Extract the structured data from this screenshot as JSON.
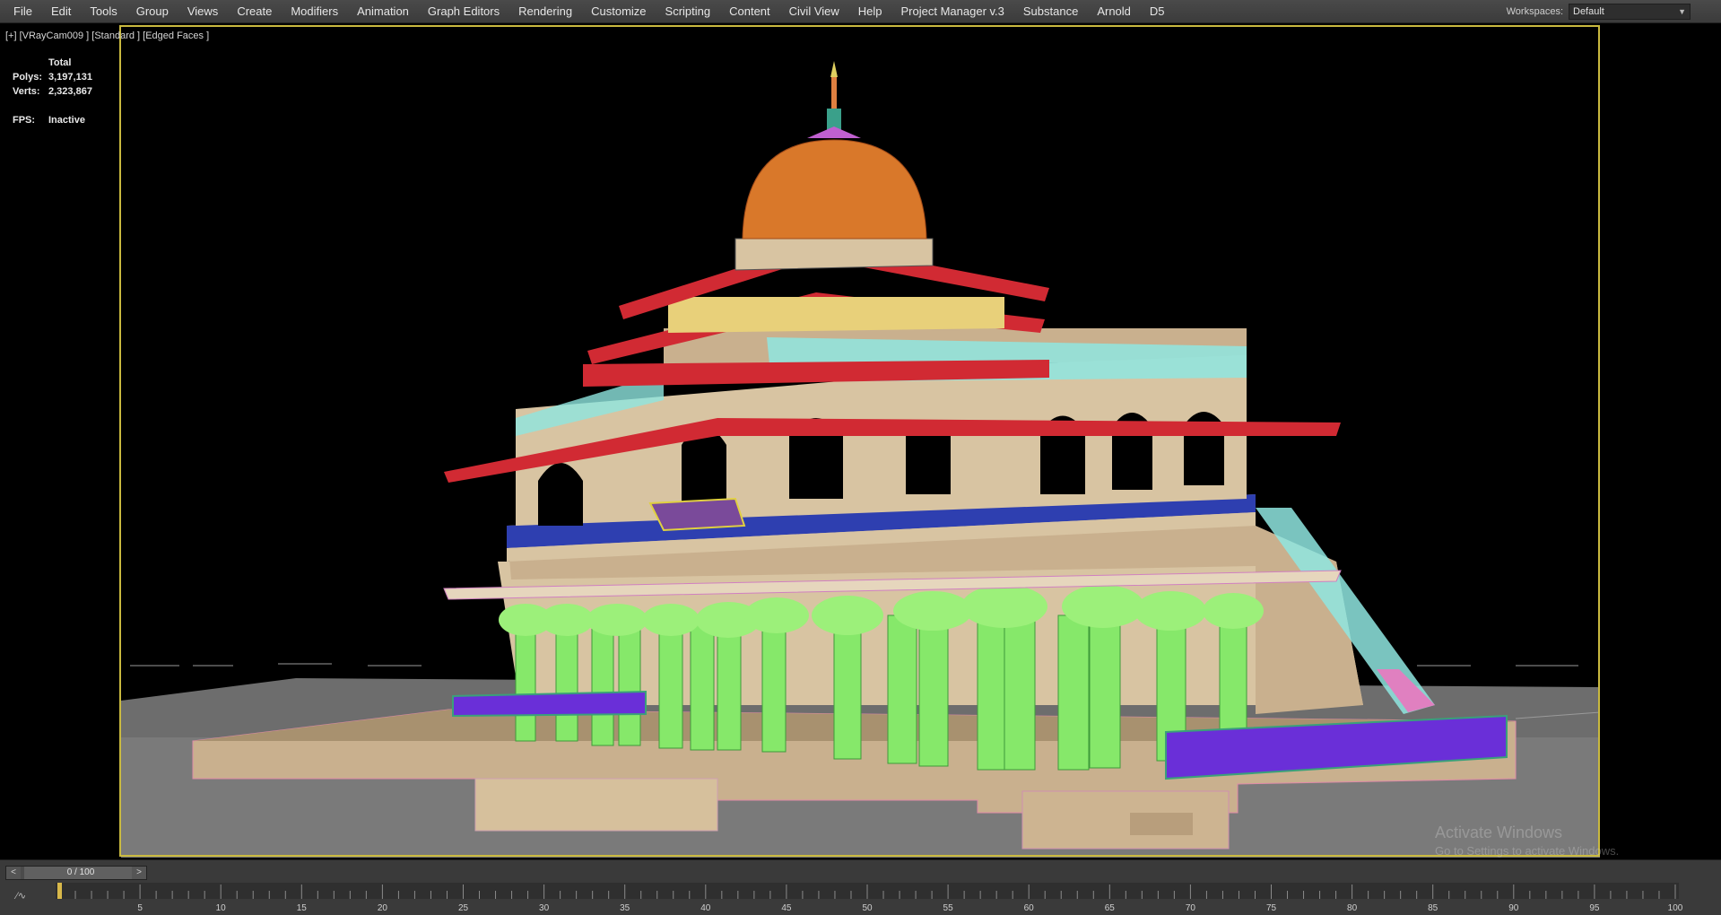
{
  "menu": {
    "items": [
      "File",
      "Edit",
      "Tools",
      "Group",
      "Views",
      "Create",
      "Modifiers",
      "Animation",
      "Graph Editors",
      "Rendering",
      "Customize",
      "Scripting",
      "Content",
      "Civil View",
      "Help",
      "Project Manager v.3",
      "Substance",
      "Arnold",
      "D5"
    ]
  },
  "workspace": {
    "label": "Workspaces:",
    "value": "Default"
  },
  "viewport": {
    "label": "[+] [VRayCam009 ] [Standard ] [Edged Faces ]",
    "stats": {
      "header": "Total",
      "polys_label": "Polys:",
      "polys_value": "3,197,131",
      "verts_label": "Verts:",
      "verts_value": "2,323,867",
      "fps_label": "FPS:",
      "fps_value": "Inactive"
    }
  },
  "watermark": {
    "line1": "Activate Windows",
    "line2": "Go to Settings to activate Windows."
  },
  "timeline": {
    "slider_text": "0 / 100",
    "current_frame": 0,
    "total_frames": 100,
    "tick_labels": [
      5,
      10,
      15,
      20,
      25,
      30,
      35,
      40,
      45,
      50,
      55,
      60,
      65,
      70,
      75,
      80,
      85,
      90,
      95,
      100
    ]
  },
  "colors": {
    "frame_border": "#c9b93f",
    "roof_red": "#d12a33",
    "dome_orange": "#d9782a",
    "pillar_green": "#86e86a",
    "stone_tan": "#d8c4a2",
    "rail_purple": "#6a2fd8",
    "lattice_cyan": "#8fe6e0"
  }
}
